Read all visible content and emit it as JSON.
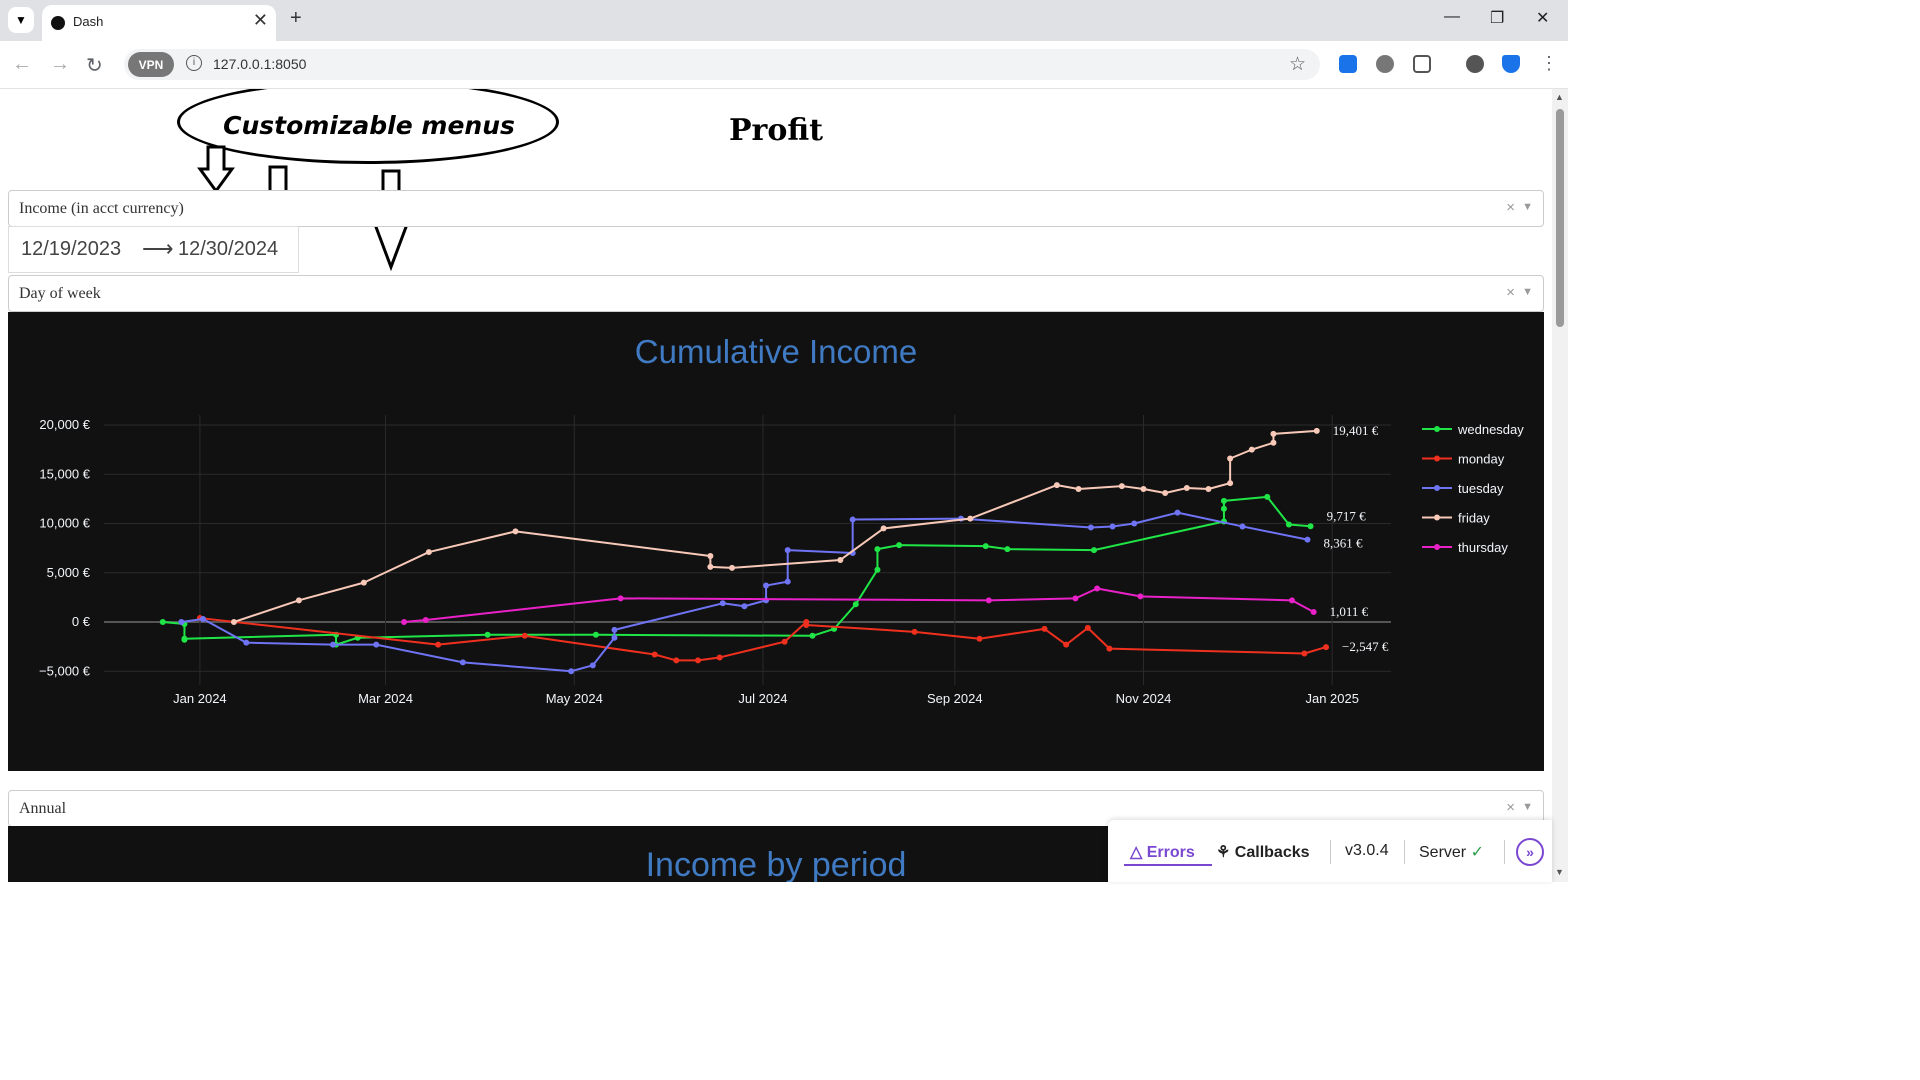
{
  "browser": {
    "tab_title": "Dash",
    "url": "127.0.0.1:8050",
    "vpn_label": "VPN"
  },
  "page": {
    "title": "Profit",
    "annotation": "Customizable menus",
    "metric_dropdown": "Income (in acct currency)",
    "date_start": "12/19/2023",
    "date_end": "12/30/2024",
    "group_dropdown": "Day of week",
    "period_dropdown": "Annual",
    "second_chart_title": "Income by period"
  },
  "devtools": {
    "errors": "Errors",
    "callbacks": "Callbacks",
    "version": "v3.0.4",
    "server": "Server"
  },
  "colors": {
    "wednesday": "#1fe646",
    "monday": "#f0301e",
    "tuesday": "#6f74f5",
    "friday": "#f8c9b8",
    "thursday": "#ea21c8",
    "title_blue": "#3f7ac2"
  },
  "chart_data": {
    "type": "line",
    "title": "Cumulative Income",
    "x_ticks": [
      "Jan 2024",
      "Mar 2024",
      "May 2024",
      "Jul 2024",
      "Sep 2024",
      "Nov 2024",
      "Jan 2025"
    ],
    "y_ticks": [
      "20,000 €",
      "15,000 €",
      "10,000 €",
      "5,000 €",
      "0 €",
      "−5,000 €"
    ],
    "ylim": [
      -5000,
      20000
    ],
    "grid": true,
    "legend_position": "right",
    "series": [
      {
        "name": "wednesday",
        "end_label": "9,717 €",
        "points": [
          [
            "2023-12-20",
            0
          ],
          [
            "2023-12-27",
            -200
          ],
          [
            "2023-12-27",
            -1800
          ],
          [
            "2023-12-27",
            -1700
          ],
          [
            "2024-02-14",
            -1300
          ],
          [
            "2024-02-14",
            -2300
          ],
          [
            "2024-02-21",
            -1600
          ],
          [
            "2024-04-03",
            -1300
          ],
          [
            "2024-05-08",
            -1300
          ],
          [
            "2024-07-17",
            -1400
          ],
          [
            "2024-07-24",
            -700
          ],
          [
            "2024-07-31",
            1800
          ],
          [
            "2024-08-07",
            5300
          ],
          [
            "2024-08-07",
            7400
          ],
          [
            "2024-08-14",
            7800
          ],
          [
            "2024-09-11",
            7700
          ],
          [
            "2024-09-18",
            7400
          ],
          [
            "2024-10-16",
            7300
          ],
          [
            "2024-11-27",
            10200
          ],
          [
            "2024-11-27",
            11500
          ],
          [
            "2024-11-27",
            12300
          ],
          [
            "2024-12-11",
            12700
          ],
          [
            "2024-12-18",
            9900
          ],
          [
            "2024-12-25",
            9717
          ]
        ]
      },
      {
        "name": "monday",
        "end_label": "−2,547 €",
        "points": [
          [
            "2024-01-01",
            400
          ],
          [
            "2024-03-18",
            -2300
          ],
          [
            "2024-04-15",
            -1400
          ],
          [
            "2024-05-27",
            -3300
          ],
          [
            "2024-06-03",
            -3900
          ],
          [
            "2024-06-10",
            -3900
          ],
          [
            "2024-06-17",
            -3600
          ],
          [
            "2024-07-08",
            -2000
          ],
          [
            "2024-07-15",
            0
          ],
          [
            "2024-07-15",
            -300
          ],
          [
            "2024-08-19",
            -1000
          ],
          [
            "2024-09-09",
            -1700
          ],
          [
            "2024-09-30",
            -700
          ],
          [
            "2024-10-07",
            -2300
          ],
          [
            "2024-10-14",
            -600
          ],
          [
            "2024-10-21",
            -2700
          ],
          [
            "2024-12-23",
            -3200
          ],
          [
            "2024-12-30",
            -2547
          ]
        ]
      },
      {
        "name": "tuesday",
        "end_label": "8,361 €",
        "points": [
          [
            "2023-12-26",
            0
          ],
          [
            "2024-01-02",
            300
          ],
          [
            "2024-01-16",
            -2100
          ],
          [
            "2024-02-13",
            -2300
          ],
          [
            "2024-02-27",
            -2300
          ],
          [
            "2024-03-26",
            -4100
          ],
          [
            "2024-04-30",
            -5000
          ],
          [
            "2024-05-07",
            -4400
          ],
          [
            "2024-05-14",
            -1600
          ],
          [
            "2024-05-14",
            -800
          ],
          [
            "2024-06-18",
            1900
          ],
          [
            "2024-06-25",
            1600
          ],
          [
            "2024-07-02",
            2200
          ],
          [
            "2024-07-02",
            3700
          ],
          [
            "2024-07-09",
            4100
          ],
          [
            "2024-07-09",
            7300
          ],
          [
            "2024-07-30",
            7000
          ],
          [
            "2024-07-30",
            10400
          ],
          [
            "2024-09-03",
            10500
          ],
          [
            "2024-10-15",
            9600
          ],
          [
            "2024-10-22",
            9700
          ],
          [
            "2024-10-29",
            10000
          ],
          [
            "2024-11-12",
            11100
          ],
          [
            "2024-12-03",
            9700
          ],
          [
            "2024-12-24",
            8361
          ]
        ]
      },
      {
        "name": "friday",
        "end_label": "19,401 €",
        "points": [
          [
            "2024-01-12",
            0
          ],
          [
            "2024-02-02",
            2200
          ],
          [
            "2024-02-23",
            4000
          ],
          [
            "2024-03-15",
            7100
          ],
          [
            "2024-04-12",
            9200
          ],
          [
            "2024-06-14",
            6700
          ],
          [
            "2024-06-14",
            5600
          ],
          [
            "2024-06-21",
            5500
          ],
          [
            "2024-07-26",
            6300
          ],
          [
            "2024-08-09",
            9500
          ],
          [
            "2024-09-06",
            10500
          ],
          [
            "2024-10-04",
            13900
          ],
          [
            "2024-10-11",
            13500
          ],
          [
            "2024-10-25",
            13800
          ],
          [
            "2024-11-01",
            13500
          ],
          [
            "2024-11-08",
            13100
          ],
          [
            "2024-11-15",
            13600
          ],
          [
            "2024-11-22",
            13500
          ],
          [
            "2024-11-29",
            14100
          ],
          [
            "2024-11-29",
            16600
          ],
          [
            "2024-12-06",
            17500
          ],
          [
            "2024-12-13",
            18200
          ],
          [
            "2024-12-13",
            19100
          ],
          [
            "2024-12-27",
            19401
          ]
        ]
      },
      {
        "name": "thursday",
        "end_label": "1,011 €",
        "points": [
          [
            "2024-03-07",
            0
          ],
          [
            "2024-03-14",
            200
          ],
          [
            "2024-05-16",
            2400
          ],
          [
            "2024-09-12",
            2200
          ],
          [
            "2024-10-10",
            2400
          ],
          [
            "2024-10-17",
            3400
          ],
          [
            "2024-10-31",
            2600
          ],
          [
            "2024-12-19",
            2200
          ],
          [
            "2024-12-26",
            1011
          ]
        ]
      }
    ]
  }
}
